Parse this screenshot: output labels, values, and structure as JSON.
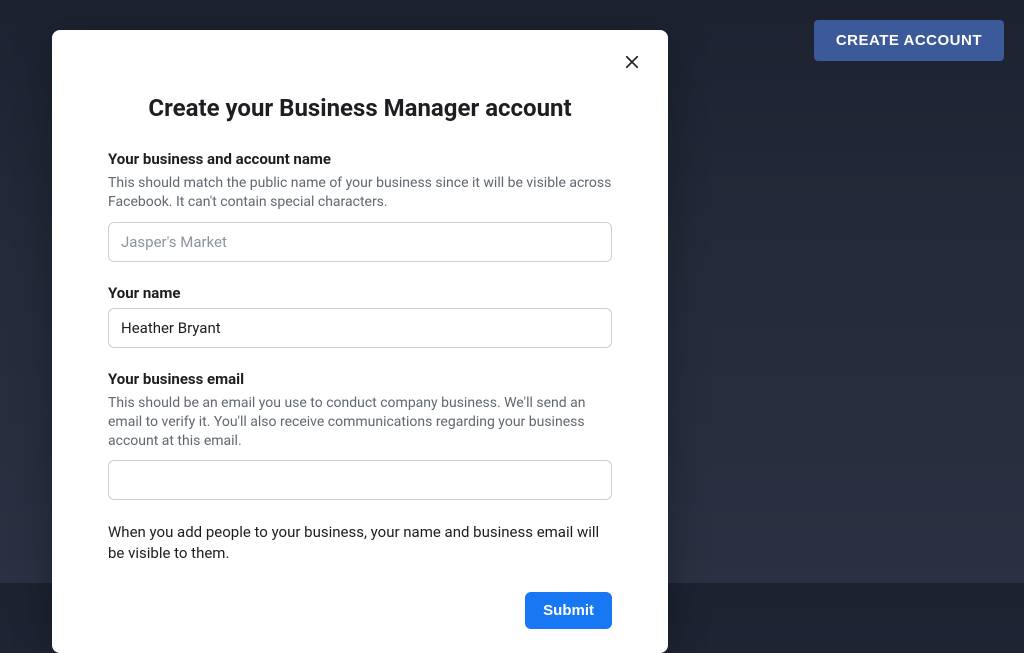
{
  "topbar": {
    "create_account_label": "CREATE ACCOUNT"
  },
  "modal": {
    "title": "Create your Business Manager account",
    "business_name": {
      "label": "Your business and account name",
      "helper": "This should match the public name of your business since it will be visible across Facebook. It can't contain special characters.",
      "placeholder": "Jasper's Market",
      "value": ""
    },
    "your_name": {
      "label": "Your name",
      "value": "Heather Bryant"
    },
    "business_email": {
      "label": "Your business email",
      "helper": "This should be an email you use to conduct company business. We'll send an email to verify it. You'll also receive communications regarding your business account at this email.",
      "value": ""
    },
    "visibility_note": "When you add people to your business, your name and business email will be visible to them.",
    "submit_label": "Submit"
  }
}
